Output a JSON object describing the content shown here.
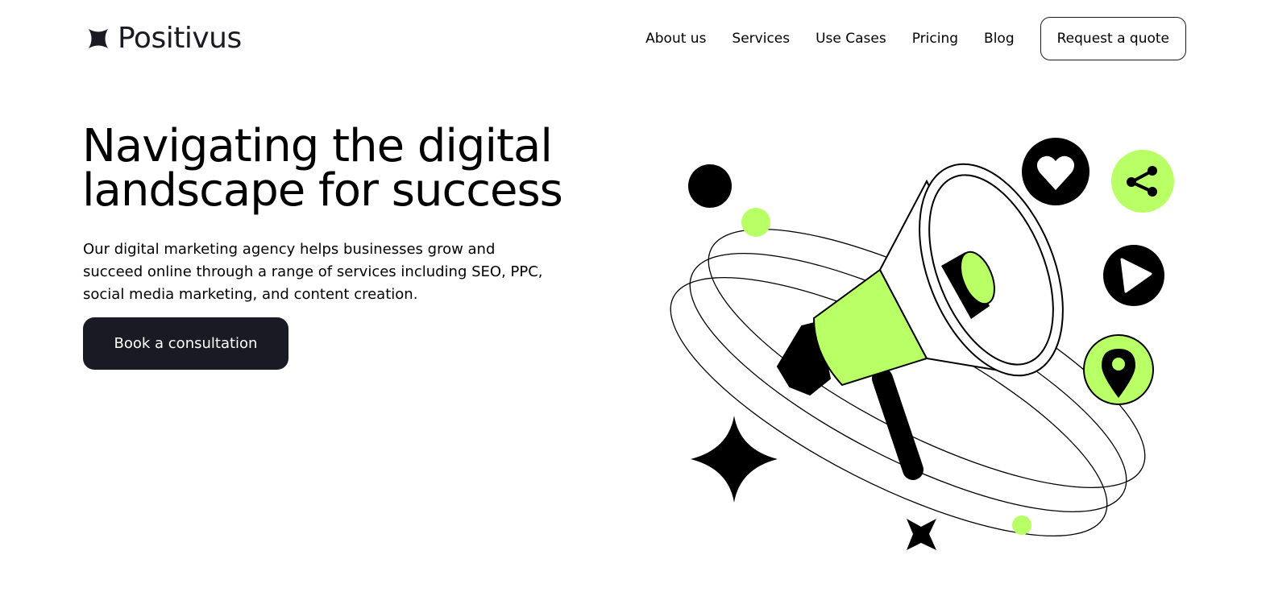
{
  "brand": {
    "name": "Positivus",
    "logo_icon": "asterisk-star-icon"
  },
  "nav": {
    "items": [
      {
        "label": "About us"
      },
      {
        "label": "Services"
      },
      {
        "label": "Use Cases"
      },
      {
        "label": "Pricing"
      },
      {
        "label": "Blog"
      }
    ],
    "cta_label": "Request a quote"
  },
  "hero": {
    "title": "Navigating the digital landscape for success",
    "description": "Our digital marketing agency helps businesses grow and succeed online through a range of services including SEO, PPC, social media marketing, and content creation.",
    "cta_label": "Book a consultation"
  },
  "illustration": {
    "icons": [
      "megaphone-icon",
      "heart-icon",
      "share-icon",
      "play-icon",
      "location-pin-icon",
      "four-point-star-icon"
    ]
  },
  "colors": {
    "accent": "#B9FF66",
    "dark": "#191A23",
    "background": "#FFFFFF",
    "text": "#000000"
  }
}
